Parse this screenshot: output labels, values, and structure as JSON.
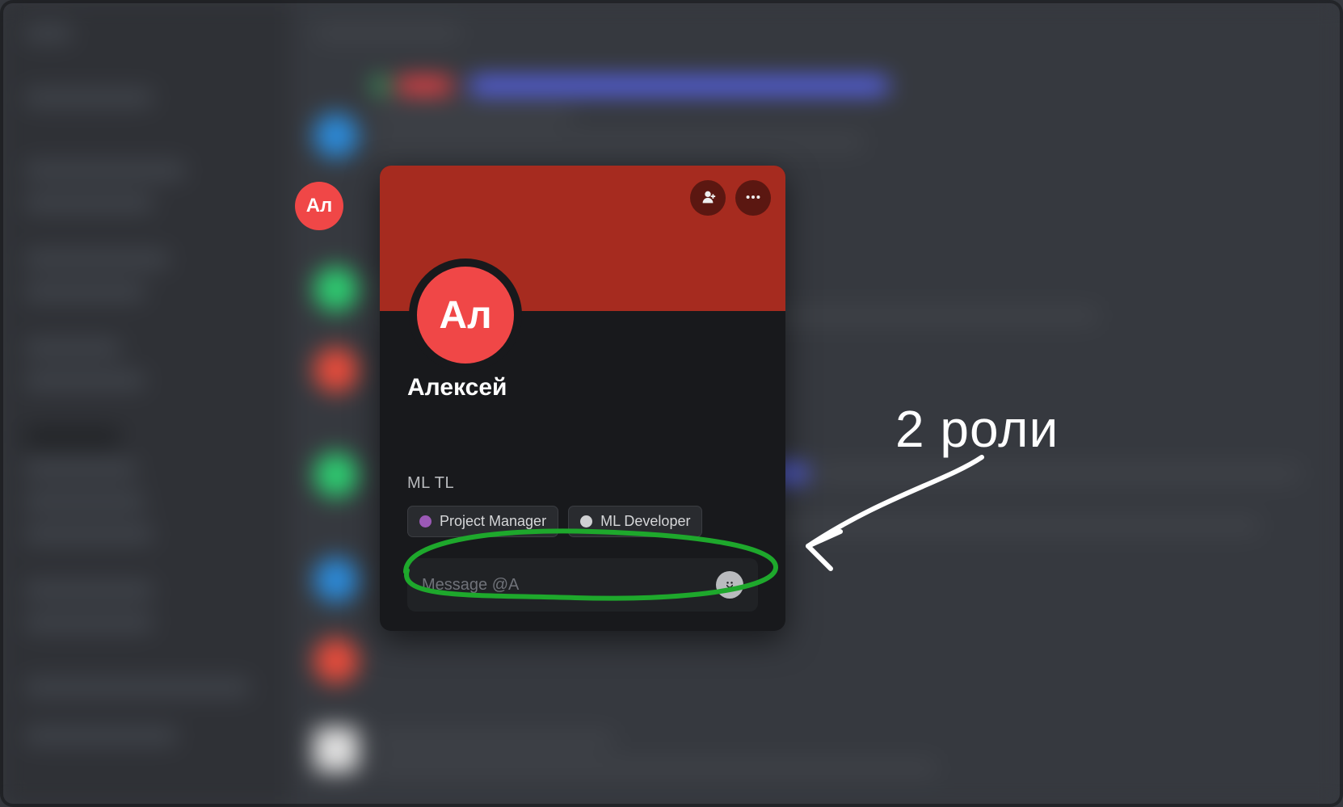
{
  "ext_avatar": {
    "initials": "Ал"
  },
  "profile": {
    "avatar_initials": "Ал",
    "username": "Алексей",
    "note_label": "ML TL",
    "roles": [
      {
        "name": "Project Manager",
        "color": "#9b59b6"
      },
      {
        "name": "ML Developer",
        "color": "#cfd0d2"
      }
    ],
    "message_placeholder": "Message @A"
  },
  "annotation": {
    "label": "2 роли"
  }
}
